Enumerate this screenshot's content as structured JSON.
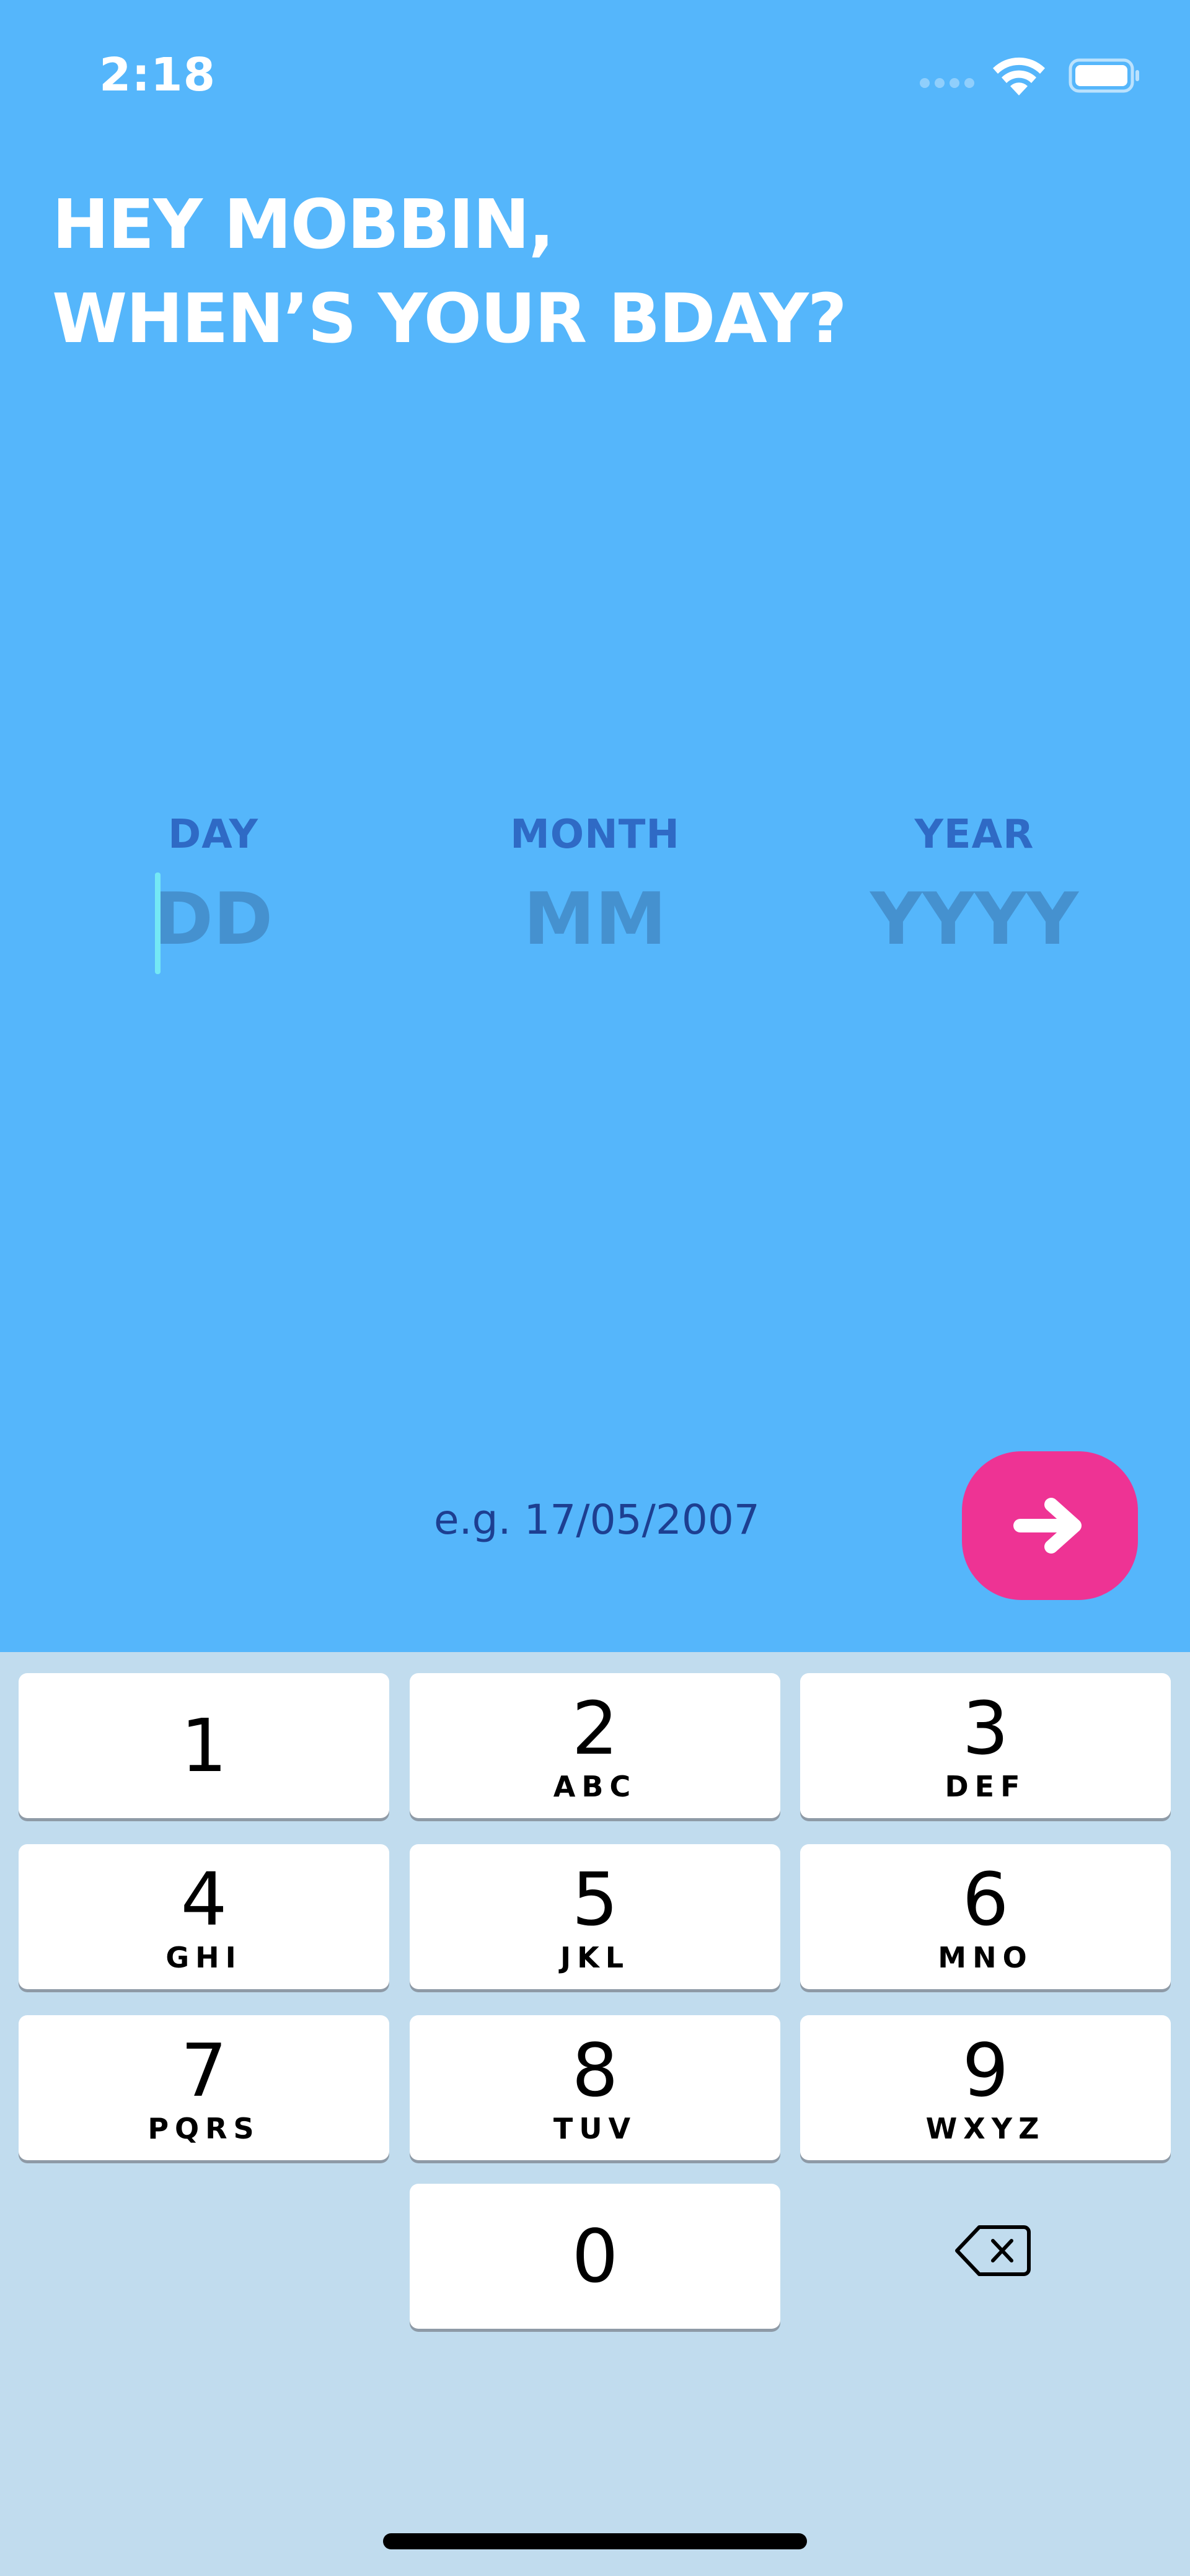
{
  "status_bar": {
    "time": "2:18"
  },
  "headline": {
    "line1": "HEY MOBBIN,",
    "line2": "WHEN’S YOUR BDAY?"
  },
  "date_fields": {
    "day": {
      "label": "DAY",
      "placeholder": "DD",
      "value": ""
    },
    "month": {
      "label": "MONTH",
      "placeholder": "MM",
      "value": ""
    },
    "year": {
      "label": "YEAR",
      "placeholder": "YYYY",
      "value": ""
    }
  },
  "hint": "e.g. 17/05/2007",
  "next_button": {
    "icon": "arrow-right-icon"
  },
  "keyboard": {
    "keys": [
      {
        "digit": "1",
        "letters": ""
      },
      {
        "digit": "2",
        "letters": "ABC"
      },
      {
        "digit": "3",
        "letters": "DEF"
      },
      {
        "digit": "4",
        "letters": "GHI"
      },
      {
        "digit": "5",
        "letters": "JKL"
      },
      {
        "digit": "6",
        "letters": "MNO"
      },
      {
        "digit": "7",
        "letters": "PQRS"
      },
      {
        "digit": "8",
        "letters": "TUV"
      },
      {
        "digit": "9",
        "letters": "WXYZ"
      },
      {
        "digit": "0",
        "letters": ""
      }
    ],
    "backspace_icon": "backspace-icon"
  },
  "colors": {
    "background": "#55b6fb",
    "accent": "#ee3394",
    "label": "#2f6ac5",
    "placeholder": "#4591cf",
    "hint": "#1d3f91",
    "keyboard_bg": "#c1dcee"
  }
}
